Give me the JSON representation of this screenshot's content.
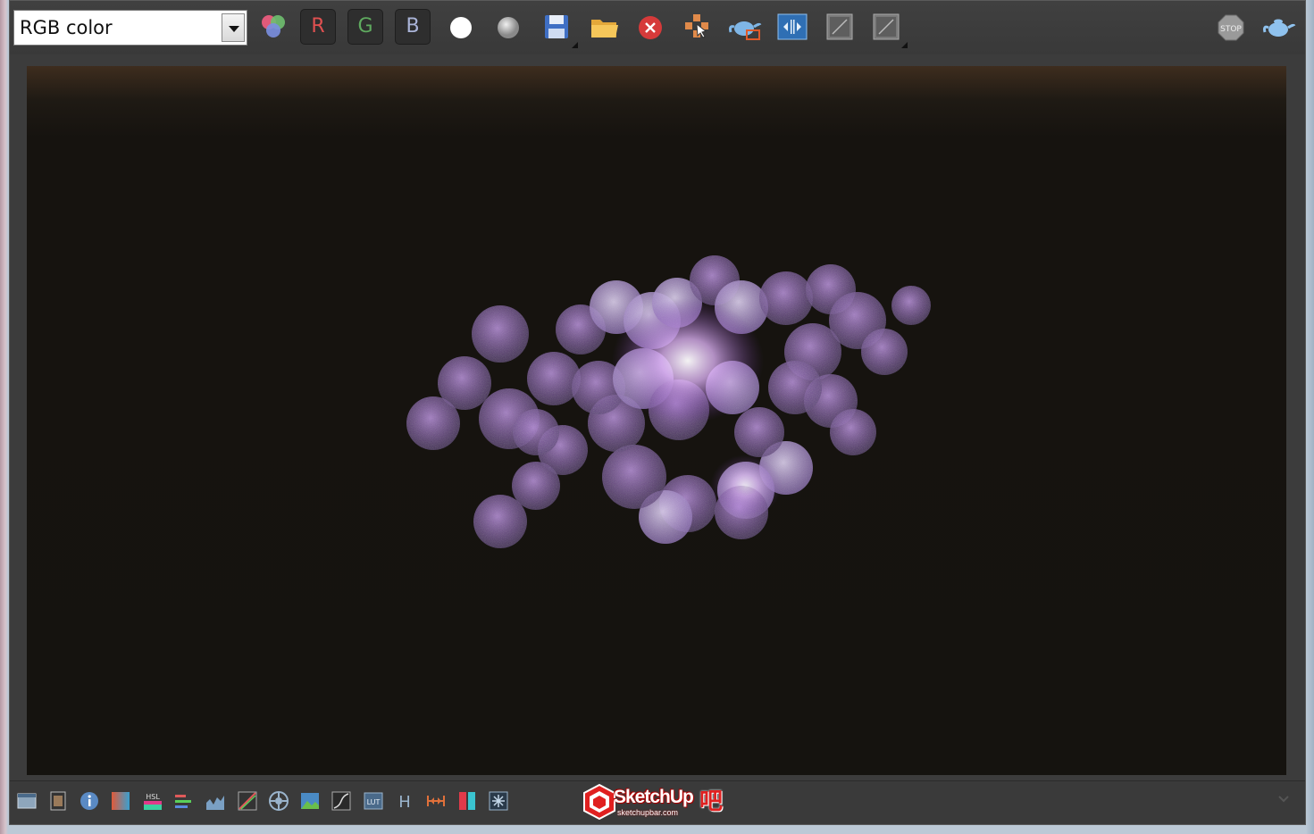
{
  "window": {
    "channel_select": {
      "value": "RGB color"
    }
  },
  "toolbar": {
    "red_channel_label": "R",
    "green_channel_label": "G",
    "blue_channel_label": "B",
    "stop_icon_label": "STOP"
  },
  "bottom_toolbar": {
    "hsl_label": "HSL",
    "lut_label": "LUT",
    "h_label": "H"
  },
  "watermark": {
    "brand": "SketchUp",
    "site": "sketchupbar.com",
    "badge": "吧"
  },
  "colors": {
    "accent_red": "#e05050",
    "accent_green": "#5faa5f",
    "accent_blue": "#aab4d8",
    "nebula": "#9b5fd0"
  }
}
